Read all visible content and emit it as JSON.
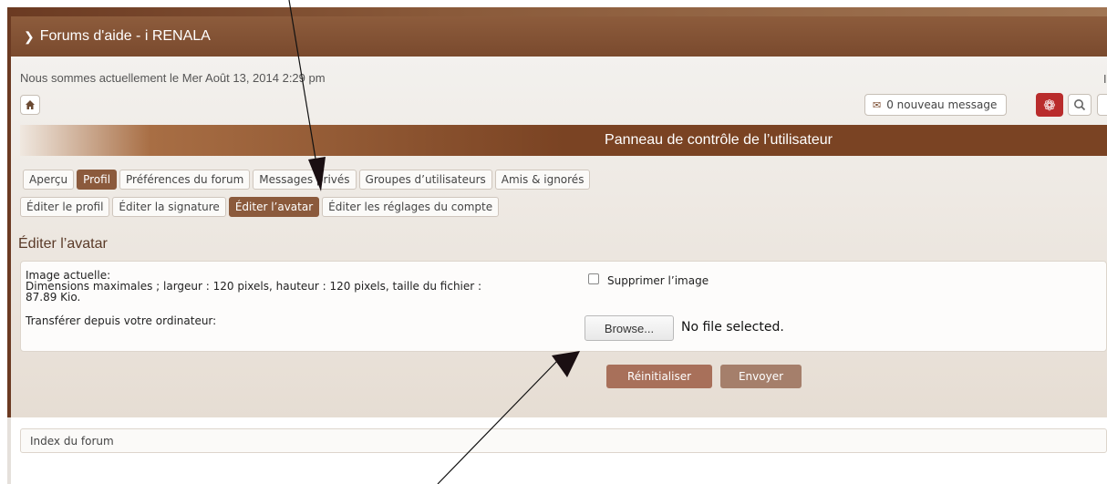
{
  "header": {
    "title": "Forums d'aide - i RENALA",
    "date_text": "Nous sommes actuellement le Mer Août 13, 2014 2:29 pm",
    "edge_char": "I"
  },
  "toolbar": {
    "new_messages": "0 nouveau message"
  },
  "panel": {
    "title": "Panneau de contrôle de l’utilisateur"
  },
  "tabs": [
    {
      "label": "Aperçu",
      "active": false
    },
    {
      "label": "Profil",
      "active": true
    },
    {
      "label": "Préférences du forum",
      "active": false
    },
    {
      "label": "Messages privés",
      "active": false
    },
    {
      "label": "Groupes d’utilisateurs",
      "active": false
    },
    {
      "label": "Amis & ignorés",
      "active": false
    }
  ],
  "subtabs": [
    {
      "label": "Éditer le profil",
      "active": false
    },
    {
      "label": "Éditer la signature",
      "active": false
    },
    {
      "label": "Éditer l’avatar",
      "active": true
    },
    {
      "label": "Éditer les réglages du compte",
      "active": false
    }
  ],
  "avatar": {
    "section_title": "Éditer l’avatar",
    "current_label": "Image actuelle:",
    "dimensions_line1": "Dimensions maximales ; largeur : 120 pixels, hauteur : 120 pixels, taille du fichier :",
    "dimensions_line2": "87.89 Kio.",
    "delete_label": "Supprimer l’image",
    "upload_label": "Transférer depuis votre ordinateur:",
    "browse_label": "Browse...",
    "file_status": "No file selected.",
    "reset_label": "Réinitialiser",
    "submit_label": "Envoyer"
  },
  "footer": {
    "index_label": "Index du forum"
  },
  "colors": {
    "brown": "#7a4a2e",
    "active_tab": "#8b5a3c",
    "alert_red": "#b92c2c"
  }
}
